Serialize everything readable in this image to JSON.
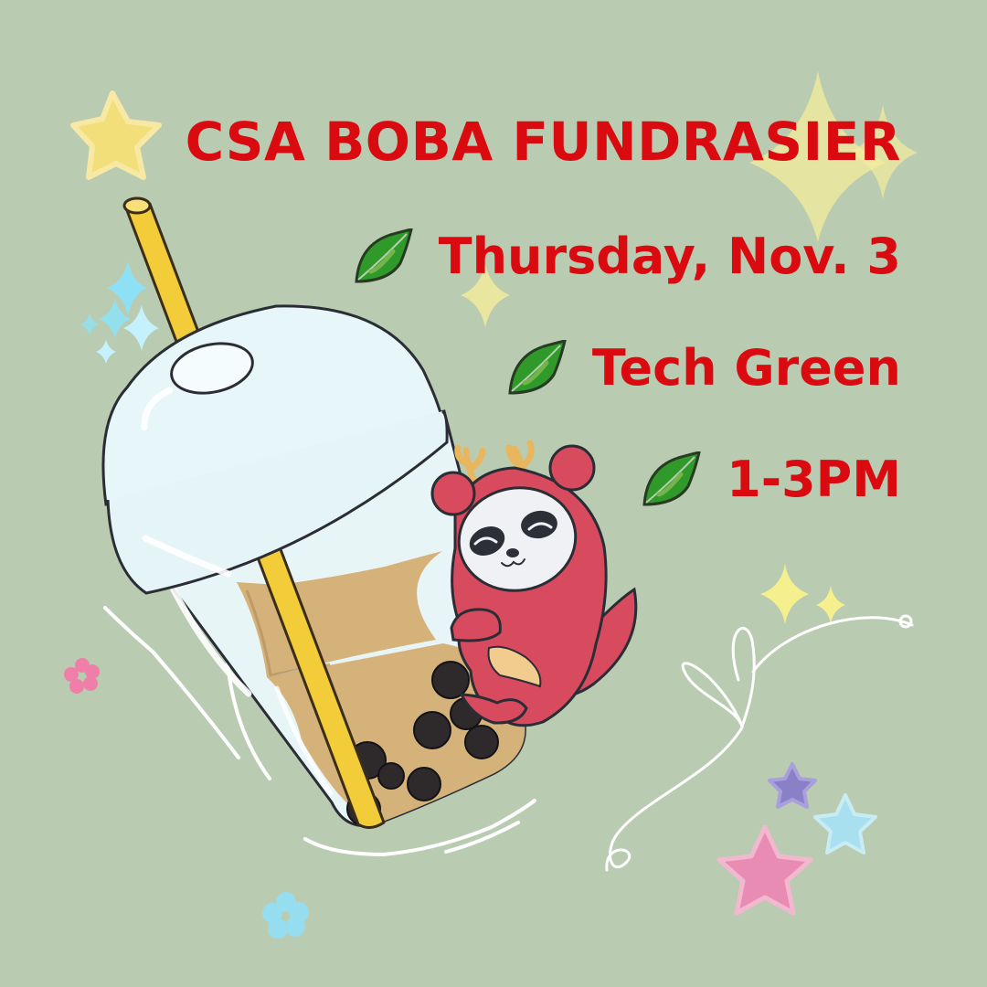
{
  "event": {
    "title": "CSA BOBA FUNDRASIER",
    "date": "Thursday, Nov. 3",
    "location": "Tech Green",
    "time": "1-3PM"
  },
  "colors": {
    "background": "#b9ccb1",
    "text": "#d90b10",
    "leaf": "#2f9a2a",
    "mascot": "#d84b5f",
    "milk_tea": "#d5b27a",
    "straw": "#f2cc39",
    "pearls": "#2e2a2b",
    "cup": "#e8f5f7",
    "star_yellow": "#f4ec9b",
    "star_pink": "#e98cb3",
    "star_blue": "#a9e0ef",
    "star_purple": "#8a80c8"
  },
  "icons": [
    "leaf-icon",
    "sparkle-icon",
    "star-icon",
    "heart-doodle",
    "boba-cup",
    "panda-mascot"
  ]
}
